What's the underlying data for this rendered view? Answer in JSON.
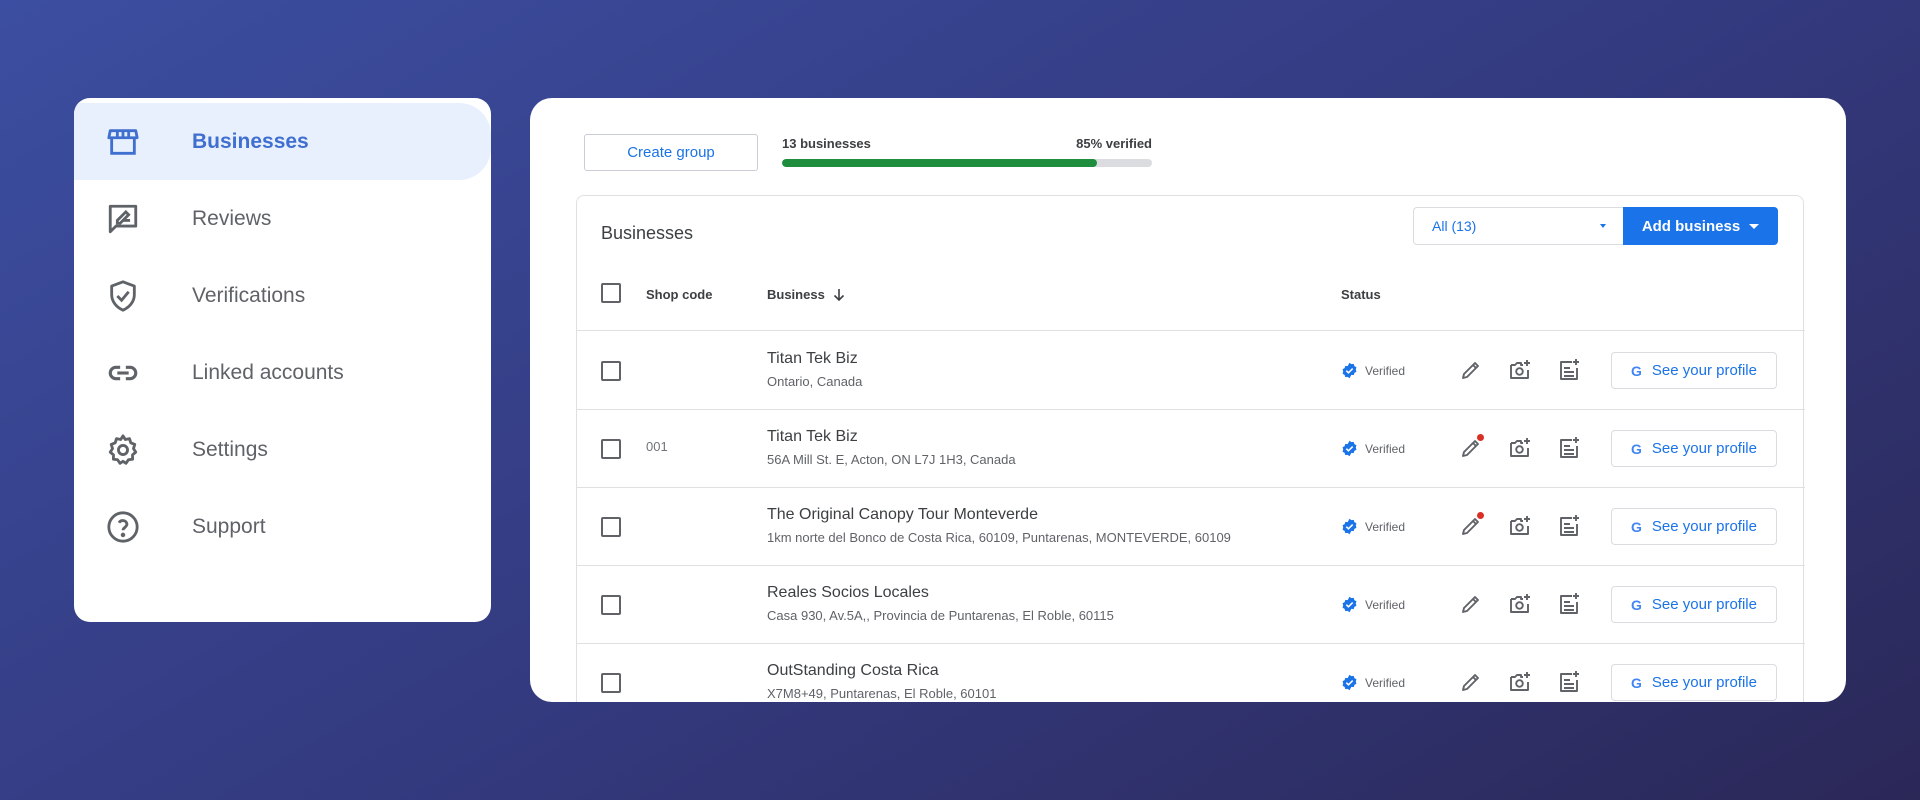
{
  "sidebar": {
    "items": [
      {
        "label": "Businesses",
        "icon": "storefront-icon",
        "active": true
      },
      {
        "label": "Reviews",
        "icon": "review-icon",
        "active": false
      },
      {
        "label": "Verifications",
        "icon": "shield-check-icon",
        "active": false
      },
      {
        "label": "Linked accounts",
        "icon": "link-icon",
        "active": false
      },
      {
        "label": "Settings",
        "icon": "gear-icon",
        "active": false
      },
      {
        "label": "Support",
        "icon": "help-icon",
        "active": false
      }
    ]
  },
  "toolbar": {
    "create_group_label": "Create group",
    "businesses_count_label": "13 businesses",
    "verified_label": "85% verified",
    "verified_fraction": 0.85
  },
  "table": {
    "title": "Businesses",
    "filter_value": "All (13)",
    "add_business_label": "Add business",
    "columns": {
      "shop_code": "Shop code",
      "business": "Business",
      "status": "Status"
    },
    "rows": [
      {
        "shop_code": "",
        "name": "Titan Tek Biz",
        "address": "Ontario, Canada",
        "status": "Verified",
        "edit_alert": false,
        "profile_label": "See your profile"
      },
      {
        "shop_code": "001",
        "name": "Titan Tek Biz",
        "address": "56A Mill St. E, Acton, ON L7J 1H3, Canada",
        "status": "Verified",
        "edit_alert": true,
        "profile_label": "See your profile"
      },
      {
        "shop_code": "",
        "name": "The Original Canopy Tour Monteverde",
        "address": "1km norte del Bonco de Costa Rica, 60109, Puntarenas, MONTEVERDE, 60109",
        "status": "Verified",
        "edit_alert": true,
        "profile_label": "See your profile"
      },
      {
        "shop_code": "",
        "name": "Reales Socios Locales",
        "address": "Casa 930, Av.5A,, Provincia de Puntarenas, El Roble, 60115",
        "status": "Verified",
        "edit_alert": false,
        "profile_label": "See your profile"
      },
      {
        "shop_code": "",
        "name": "OutStanding Costa Rica",
        "address": "X7M8+49, Puntarenas, El Roble, 60101",
        "status": "Verified",
        "edit_alert": false,
        "profile_label": "See your profile"
      }
    ]
  },
  "colors": {
    "accent": "#1a73e8",
    "progress": "#1e8e3e",
    "alert": "#d93025"
  }
}
